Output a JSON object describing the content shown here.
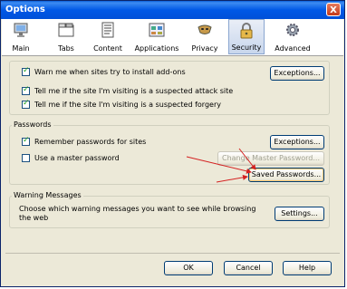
{
  "window": {
    "title": "Options",
    "close_label": "X"
  },
  "tabs": [
    {
      "label": "Main",
      "icon": "monitor-icon"
    },
    {
      "label": "Tabs",
      "icon": "tabs-icon"
    },
    {
      "label": "Content",
      "icon": "content-icon"
    },
    {
      "label": "Applications",
      "icon": "applications-icon"
    },
    {
      "label": "Privacy",
      "icon": "mask-icon"
    },
    {
      "label": "Security",
      "icon": "padlock-icon",
      "selected": true
    },
    {
      "label": "Advanced",
      "icon": "gear-icon"
    }
  ],
  "security": {
    "warn_addons": {
      "label": "Warn me when sites try to install add-ons",
      "checked": true
    },
    "attack_site": {
      "label": "Tell me if the site I'm visiting is a suspected attack site",
      "checked": true
    },
    "forgery": {
      "label": "Tell me if the site I'm visiting is a suspected forgery",
      "checked": true
    },
    "exceptions_label": "Exceptions..."
  },
  "passwords": {
    "group_label": "Passwords",
    "remember": {
      "label": "Remember passwords for sites",
      "checked": true
    },
    "master": {
      "label": "Use a master password",
      "checked": false
    },
    "exceptions_label": "Exceptions...",
    "change_master_label": "Change Master Password...",
    "saved_passwords_label": "Saved Passwords..."
  },
  "warnings": {
    "group_label": "Warning Messages",
    "description": "Choose which warning messages you want to see while browsing the web",
    "settings_label": "Settings..."
  },
  "footer": {
    "ok_label": "OK",
    "cancel_label": "Cancel",
    "help_label": "Help"
  },
  "colors": {
    "titlebar": "#0058e6",
    "annotation_arrow": "#d42020",
    "check": "#21a121"
  }
}
